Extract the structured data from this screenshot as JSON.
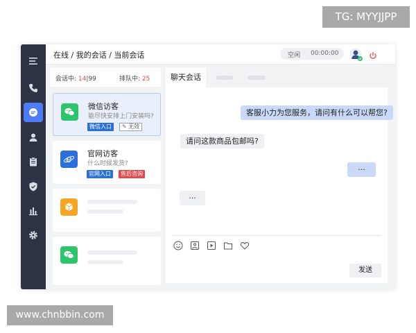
{
  "watermarks": {
    "top": "TG: MYYJJPP",
    "bottom": "www.chnbbin.com"
  },
  "colors": {
    "sidebar_bg": "#2c3345",
    "sidebar_active": "#4e7cf6",
    "tag_blue": "#2a6fdc",
    "tag_red": "#e5484d",
    "agent_bubble": "#c9d9f7",
    "wechat_green": "#2ec46b",
    "web_blue": "#2a6fdc",
    "box_orange": "#f5a524"
  },
  "sidebar": {
    "items": [
      {
        "icon": "menu-icon",
        "active": false
      },
      {
        "icon": "phone-icon",
        "active": false
      },
      {
        "icon": "chat-icon",
        "active": true
      },
      {
        "icon": "user-icon",
        "active": false
      },
      {
        "icon": "clipboard-icon",
        "active": false
      },
      {
        "icon": "shield-icon",
        "active": false
      },
      {
        "icon": "bar-chart-icon",
        "active": false
      },
      {
        "icon": "gear-icon",
        "active": false
      }
    ]
  },
  "header": {
    "breadcrumb": "在线 / 我的会话 / 当前会话",
    "status": "空闲",
    "timer": "00:00:00",
    "avatar_icon": "agent-avatar-icon",
    "power_icon": "power-icon"
  },
  "counts": {
    "in_session_label": "会话中:",
    "in_session_value": "14",
    "separator": "|",
    "in_session_max": "99",
    "queue_label": "排队中:",
    "queue_value": "25"
  },
  "conversations": [
    {
      "name": "微信访客",
      "message": "能尽快安排上门安装吗?",
      "icon": "wechat-icon",
      "tags": [
        "微信入口",
        "无效"
      ],
      "selected": true
    },
    {
      "name": "官网访客",
      "message": "什么时候发货?",
      "icon": "ie-browser-icon",
      "tags": [
        "官网入口",
        "售后咨询"
      ],
      "selected": false
    },
    {
      "icon": "box-icon"
    },
    {
      "icon": "wechat-icon"
    }
  ],
  "chat": {
    "tab_label": "聊天会话",
    "messages": [
      {
        "from": "agent",
        "text": "客服小力为您服务，请问有什么可以帮您?"
      },
      {
        "from": "visitor",
        "text": "请问这款商品包邮吗?"
      },
      {
        "from": "agent",
        "text": "···"
      },
      {
        "from": "visitor",
        "text": "···"
      }
    ],
    "toolbar": [
      "emoji-icon",
      "image-icon",
      "video-icon",
      "folder-icon",
      "heart-icon"
    ],
    "send_label": "发送"
  }
}
